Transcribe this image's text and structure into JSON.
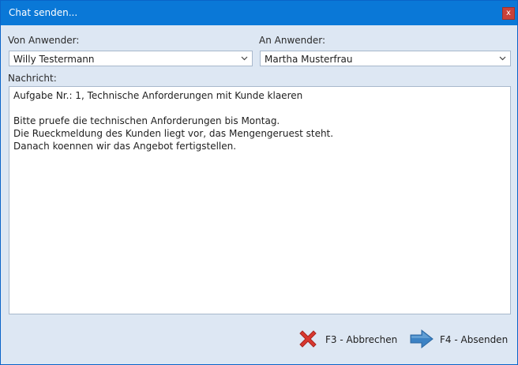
{
  "window": {
    "title": "Chat senden...",
    "close_label": "x"
  },
  "from_user": {
    "label": "Von Anwender:",
    "value": "Willy Testermann"
  },
  "to_user": {
    "label": "An Anwender:",
    "value": "Martha Musterfrau"
  },
  "message": {
    "label": "Nachricht:",
    "lines": [
      "Aufgabe Nr.: 1, Technische Anforderungen mit Kunde klaeren",
      "",
      "Bitte pruefe die technischen Anforderungen bis Montag.",
      "Die Rueckmeldung des Kunden liegt vor, das Mengengeruest steht.",
      "Danach koennen wir das Angebot fertigstellen."
    ]
  },
  "buttons": {
    "cancel": {
      "label": "F3 - Abbrechen",
      "icon": "red-x-icon"
    },
    "send": {
      "label": "F4 - Absenden",
      "icon": "blue-arrow-right-icon"
    }
  },
  "colors": {
    "titlebar": "#0a78d7",
    "background": "#dde7f3",
    "close_button": "#c9423a",
    "cancel_icon": "#d9382f",
    "send_icon": "#3c82c4"
  }
}
